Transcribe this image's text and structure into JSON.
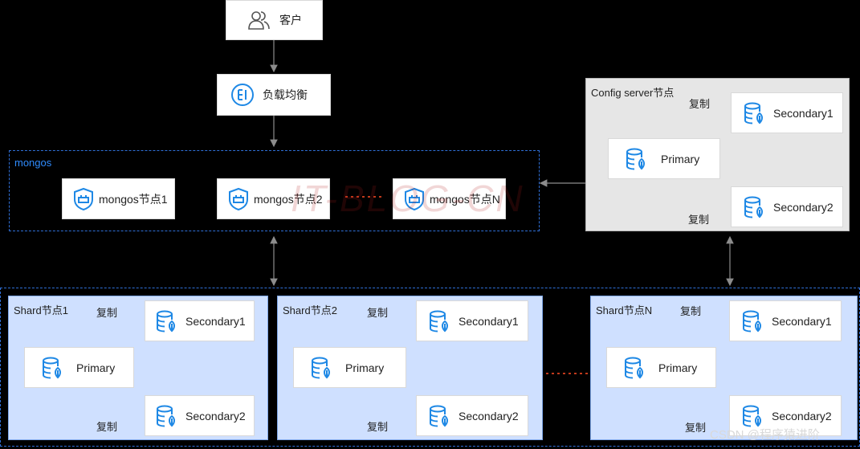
{
  "client": {
    "label": "客户",
    "icon": "users-icon"
  },
  "load_balancer": {
    "label": "负载均衡",
    "icon": "load-balancer-icon"
  },
  "mongos": {
    "group_label": "mongos",
    "nodes": [
      {
        "label": "mongos节点1",
        "icon": "shield-router-icon"
      },
      {
        "label": "mongos节点2",
        "icon": "shield-router-icon"
      },
      {
        "label": "mongos节点N",
        "icon": "shield-router-icon"
      }
    ]
  },
  "config_server": {
    "label": "Config server节点",
    "primary": "Primary",
    "secondary1": "Secondary1",
    "secondary2": "Secondary2",
    "copy_top": "复制",
    "copy_bottom": "复制"
  },
  "shards": [
    {
      "label": "Shard节点1",
      "primary": "Primary",
      "secondary1": "Secondary1",
      "secondary2": "Secondary2",
      "copy_top": "复制",
      "copy_bottom": "复制"
    },
    {
      "label": "Shard节点2",
      "primary": "Primary",
      "secondary1": "Secondary1",
      "secondary2": "Secondary2",
      "copy_top": "复制",
      "copy_bottom": "复制"
    },
    {
      "label": "Shard节点N",
      "primary": "Primary",
      "secondary1": "Secondary1",
      "secondary2": "Secondary2",
      "copy_top": "复制",
      "copy_bottom": "复制"
    }
  ],
  "watermark": "IT-BLOG-CN",
  "footer": "CSDN @程序猿进阶",
  "colors": {
    "icon_blue": "#1e88e5",
    "dots": "#c0391b",
    "arrow": "#8c8c8c"
  }
}
